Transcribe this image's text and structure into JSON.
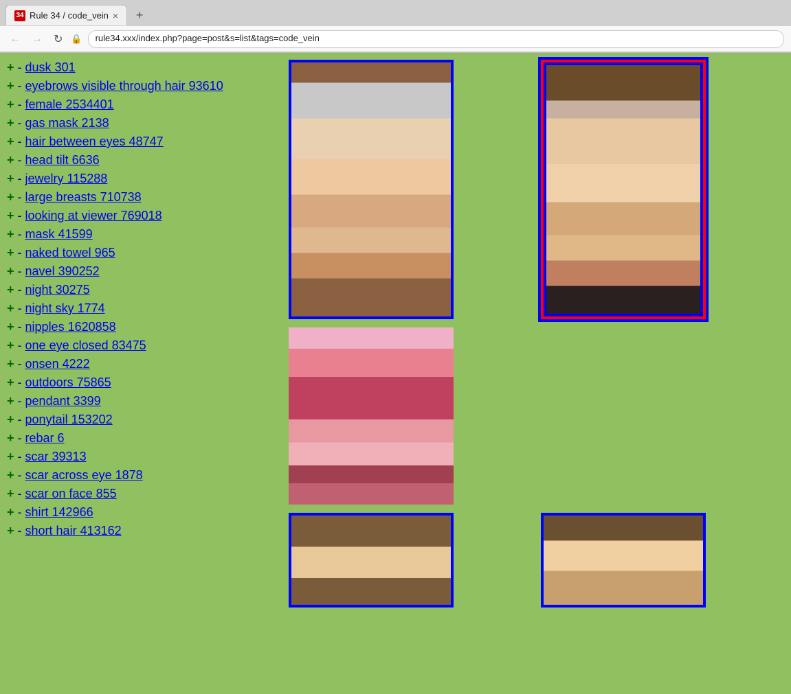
{
  "browser": {
    "tab_favicon": "34",
    "tab_title": "Rule 34 / code_vein",
    "tab_close": "×",
    "new_tab": "+",
    "nav_back": "←",
    "nav_forward": "→",
    "nav_refresh": "↻",
    "url": "rule34.xxx/index.php?page=post&s=list&tags=code_vein",
    "lock_icon": "🔒"
  },
  "sidebar": {
    "items": [
      {
        "id": "dusk",
        "plus": "+",
        "minus": "-",
        "label": "dusk",
        "count": "301"
      },
      {
        "id": "eyebrows-visible",
        "plus": "+",
        "minus": "-",
        "label": "eyebrows visible through hair",
        "count": "93610"
      },
      {
        "id": "female",
        "plus": "+",
        "minus": "-",
        "label": "female",
        "count": "2534401"
      },
      {
        "id": "gas-mask",
        "plus": "+",
        "minus": "-",
        "label": "gas mask",
        "count": "2138"
      },
      {
        "id": "hair-between-eyes",
        "plus": "+",
        "minus": "-",
        "label": "hair between eyes",
        "count": "48747"
      },
      {
        "id": "head-tilt",
        "plus": "+",
        "minus": "-",
        "label": "head tilt",
        "count": "6636"
      },
      {
        "id": "jewelry",
        "plus": "+",
        "minus": "-",
        "label": "jewelry",
        "count": "115288"
      },
      {
        "id": "large-breasts",
        "plus": "+",
        "minus": "-",
        "label": "large breasts",
        "count": "710738"
      },
      {
        "id": "looking-at-viewer",
        "plus": "+",
        "minus": "-",
        "label": "looking at viewer",
        "count": "769018"
      },
      {
        "id": "mask",
        "plus": "+",
        "minus": "-",
        "label": "mask",
        "count": "41599"
      },
      {
        "id": "naked-towel",
        "plus": "+",
        "minus": "-",
        "label": "naked towel",
        "count": "965"
      },
      {
        "id": "navel",
        "plus": "+",
        "minus": "-",
        "label": "navel",
        "count": "390252"
      },
      {
        "id": "night",
        "plus": "+",
        "minus": "-",
        "label": "night",
        "count": "30275"
      },
      {
        "id": "night-sky",
        "plus": "+",
        "minus": "-",
        "label": "night sky",
        "count": "1774"
      },
      {
        "id": "nipples",
        "plus": "+",
        "minus": "-",
        "label": "nipples",
        "count": "1620858"
      },
      {
        "id": "one-eye-closed",
        "plus": "+",
        "minus": "-",
        "label": "one eye closed",
        "count": "83475"
      },
      {
        "id": "onsen",
        "plus": "+",
        "minus": "-",
        "label": "onsen",
        "count": "4222"
      },
      {
        "id": "outdoors",
        "plus": "+",
        "minus": "-",
        "label": "outdoors",
        "count": "75865"
      },
      {
        "id": "pendant",
        "plus": "+",
        "minus": "-",
        "label": "pendant",
        "count": "3399"
      },
      {
        "id": "ponytail",
        "plus": "+",
        "minus": "-",
        "label": "ponytail",
        "count": "153202"
      },
      {
        "id": "rebar",
        "plus": "+",
        "minus": "-",
        "label": "rebar",
        "count": "6"
      },
      {
        "id": "scar",
        "plus": "+",
        "minus": "-",
        "label": "scar",
        "count": "39313"
      },
      {
        "id": "scar-across-eye",
        "plus": "+",
        "minus": "-",
        "label": "scar across eye",
        "count": "1878"
      },
      {
        "id": "scar-on-face",
        "plus": "+",
        "minus": "-",
        "label": "scar on face",
        "count": "855"
      },
      {
        "id": "shirt",
        "plus": "+",
        "minus": "-",
        "label": "shirt",
        "count": "142966"
      },
      {
        "id": "short-hair",
        "plus": "+",
        "minus": "-",
        "label": "short hair",
        "count": "413162"
      }
    ]
  },
  "images": [
    {
      "id": "img-1",
      "border": "blue",
      "alt": "Image 1"
    },
    {
      "id": "img-2",
      "border": "red-blue",
      "alt": "Image 2"
    },
    {
      "id": "img-3",
      "border": "none",
      "alt": "Image 3"
    },
    {
      "id": "img-4",
      "border": "none",
      "alt": "Image 4"
    },
    {
      "id": "img-5",
      "border": "blue",
      "alt": "Image 5"
    },
    {
      "id": "img-6",
      "border": "blue",
      "alt": "Image 6"
    }
  ]
}
